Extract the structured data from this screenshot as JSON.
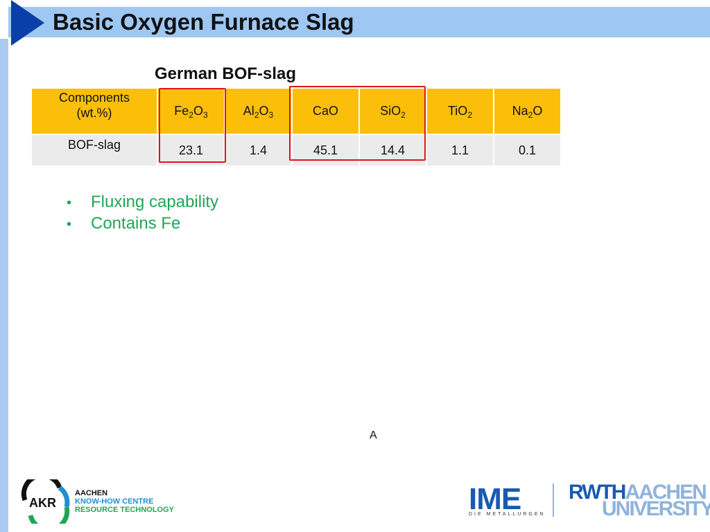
{
  "slide": {
    "title": "Basic Oxygen Furnace Slag",
    "table_title": "German BOF-slag"
  },
  "table": {
    "header_label_line1": "Components",
    "header_label_line2": "(wt.%)",
    "columns": [
      {
        "base": "Fe",
        "s1": "2",
        "mid": "O",
        "s2": "3"
      },
      {
        "base": "Al",
        "s1": "2",
        "mid": "O",
        "s2": "3"
      },
      {
        "base": "CaO",
        "s1": "",
        "mid": "",
        "s2": ""
      },
      {
        "base": "SiO",
        "s1": "2",
        "mid": "",
        "s2": ""
      },
      {
        "base": "TiO",
        "s1": "2",
        "mid": "",
        "s2": ""
      },
      {
        "base": "Na",
        "s1": "2",
        "mid": "O",
        "s2": ""
      }
    ],
    "row_label": "BOF-slag",
    "values": [
      "23.1",
      "1.4",
      "45.1",
      "14.4",
      "1.1",
      "0.1"
    ],
    "highlight_color": "#e0141e",
    "header_color": "#fbbf0a"
  },
  "bullets": [
    "Fluxing capability",
    "Contains Fe"
  ],
  "stray_mark": "A",
  "logos": {
    "akr_letters": "AKR",
    "akr_line1": "AACHEN",
    "akr_line2": "KNOW-HOW CENTRE",
    "akr_line3": "RESOURCE TECHNOLOGY",
    "ime": "IME",
    "ime_sub": "DIE METALLURGEN",
    "rwth": "RWTH",
    "aachen": "AACHEN",
    "university": "UNIVERSITY"
  },
  "colors": {
    "title_bar": "#9ec7f3",
    "title_arrow": "#0b3fa8",
    "bullet_text": "#1fa655"
  }
}
